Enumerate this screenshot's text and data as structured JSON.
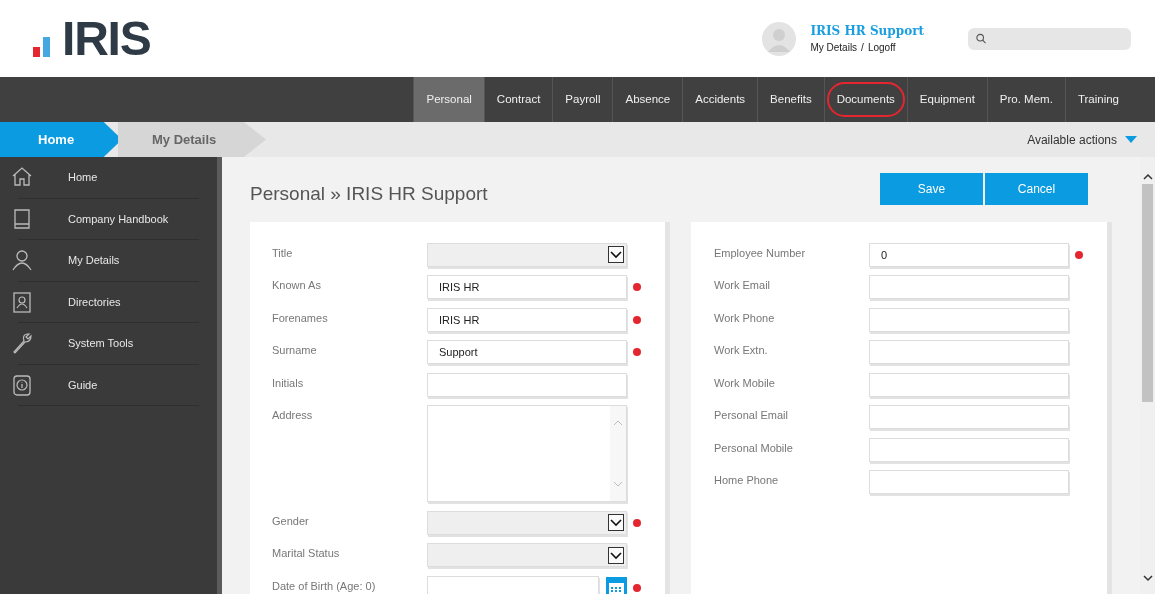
{
  "logo": {
    "text": "IRIS"
  },
  "user": {
    "name": "IRIS HR Support",
    "details_link": "My Details",
    "separator": "/",
    "logoff_link": "Logoff"
  },
  "tabs": [
    {
      "label": "Personal",
      "selected": true,
      "circled": false
    },
    {
      "label": "Contract",
      "selected": false,
      "circled": false
    },
    {
      "label": "Payroll",
      "selected": false,
      "circled": false
    },
    {
      "label": "Absence",
      "selected": false,
      "circled": false
    },
    {
      "label": "Accidents",
      "selected": false,
      "circled": false
    },
    {
      "label": "Benefits",
      "selected": false,
      "circled": false
    },
    {
      "label": "Documents",
      "selected": false,
      "circled": true
    },
    {
      "label": "Equipment",
      "selected": false,
      "circled": false
    },
    {
      "label": "Pro. Mem.",
      "selected": false,
      "circled": false
    },
    {
      "label": "Training",
      "selected": false,
      "circled": false
    }
  ],
  "breadcrumb": [
    {
      "label": "Home",
      "selected": true
    },
    {
      "label": "My Details",
      "selected": false
    }
  ],
  "available_actions": "Available actions",
  "sidebar": {
    "items": [
      {
        "label": "Home"
      },
      {
        "label": "Company Handbook"
      },
      {
        "label": "My Details"
      },
      {
        "label": "Directories"
      },
      {
        "label": "System Tools"
      },
      {
        "label": "Guide"
      }
    ]
  },
  "page_title": "Personal » IRIS HR Support",
  "buttons": [
    "Save",
    "Cancel"
  ],
  "left_fields": [
    {
      "label": "Title",
      "kind": "select",
      "required": false
    },
    {
      "label": "Known As",
      "kind": "text",
      "value": "IRIS HR",
      "required": true
    },
    {
      "label": "Forenames",
      "kind": "text",
      "value": "IRIS HR",
      "required": true
    },
    {
      "label": "Surname",
      "kind": "text",
      "value": "Support",
      "required": true
    },
    {
      "label": "Initials",
      "kind": "text",
      "required": false
    },
    {
      "label": "Address",
      "kind": "textarea",
      "required": false
    },
    {
      "label": "Gender",
      "kind": "select",
      "required": true
    },
    {
      "label": "Marital Status",
      "kind": "select",
      "required": false
    },
    {
      "label": "Date of Birth (Age: 0)",
      "kind": "date",
      "required": true
    }
  ],
  "right_fields": [
    {
      "label": "Employee Number",
      "kind": "text",
      "value": "0",
      "required": true
    },
    {
      "label": "Work Email",
      "kind": "text",
      "required": false
    },
    {
      "label": "Work Phone",
      "kind": "text",
      "required": false
    },
    {
      "label": "Work Extn.",
      "kind": "text",
      "required": false
    },
    {
      "label": "Work Mobile",
      "kind": "text",
      "required": false
    },
    {
      "label": "Personal Email",
      "kind": "text",
      "required": false
    },
    {
      "label": "Personal Mobile",
      "kind": "text",
      "required": false
    },
    {
      "label": "Home Phone",
      "kind": "text",
      "required": false
    }
  ]
}
